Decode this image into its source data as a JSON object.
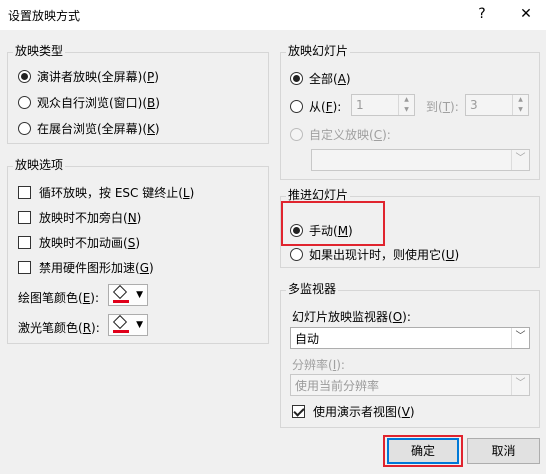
{
  "window": {
    "title": "设置放映方式",
    "help": "?",
    "close": "✕"
  },
  "show_type": {
    "label": "放映类型",
    "options": [
      {
        "text": "演讲者放映(全屏幕)(",
        "key": "P",
        "end": ")",
        "checked": true
      },
      {
        "text": "观众自行浏览(窗口)(",
        "key": "B",
        "end": ")",
        "checked": false
      },
      {
        "text": "在展台浏览(全屏幕)(",
        "key": "K",
        "end": ")",
        "checked": false
      }
    ]
  },
  "show_options": {
    "label": "放映选项",
    "checks": [
      {
        "text": "循环放映，按 ESC 键终止(",
        "key": "L",
        "end": ")"
      },
      {
        "text": "放映时不加旁白(",
        "key": "N",
        "end": ")"
      },
      {
        "text": "放映时不加动画(",
        "key": "S",
        "end": ")"
      },
      {
        "text": "禁用硬件图形加速(",
        "key": "G",
        "end": ")"
      }
    ],
    "pen_color": {
      "text": "绘图笔颜色(",
      "key": "E",
      "end": "):"
    },
    "laser_color": {
      "text": "激光笔颜色(",
      "key": "R",
      "end": "):"
    }
  },
  "slides": {
    "label": "放映幻灯片",
    "all": {
      "text": "全部(",
      "key": "A",
      "end": ")"
    },
    "from": {
      "text": "从(",
      "key": "F",
      "end": "):",
      "value": "1"
    },
    "to": {
      "text": "到(",
      "key": "T",
      "end": "):",
      "value": "3"
    },
    "custom": {
      "text": "自定义放映(",
      "key": "C",
      "end": "):"
    }
  },
  "advance": {
    "label": "推进幻灯片",
    "manual": {
      "text": "手动(",
      "key": "M",
      "end": ")"
    },
    "timing": {
      "text": "如果出现计时，则使用它(",
      "key": "U",
      "end": ")"
    }
  },
  "monitors": {
    "label": "多监视器",
    "monitor_label": {
      "text": "幻灯片放映监视器(",
      "key": "O",
      "end": "):"
    },
    "monitor_value": "自动",
    "resolution_label": {
      "text": "分辨率(",
      "key": "I",
      "end": "):"
    },
    "resolution_value": "使用当前分辨率",
    "presenter": {
      "text": "使用演示者视图(",
      "key": "V",
      "end": ")"
    }
  },
  "buttons": {
    "ok": "确定",
    "cancel": "取消"
  },
  "colors": {
    "accent": "#0078d7",
    "highlight": "#e0242e",
    "pen": "#e0001a"
  }
}
